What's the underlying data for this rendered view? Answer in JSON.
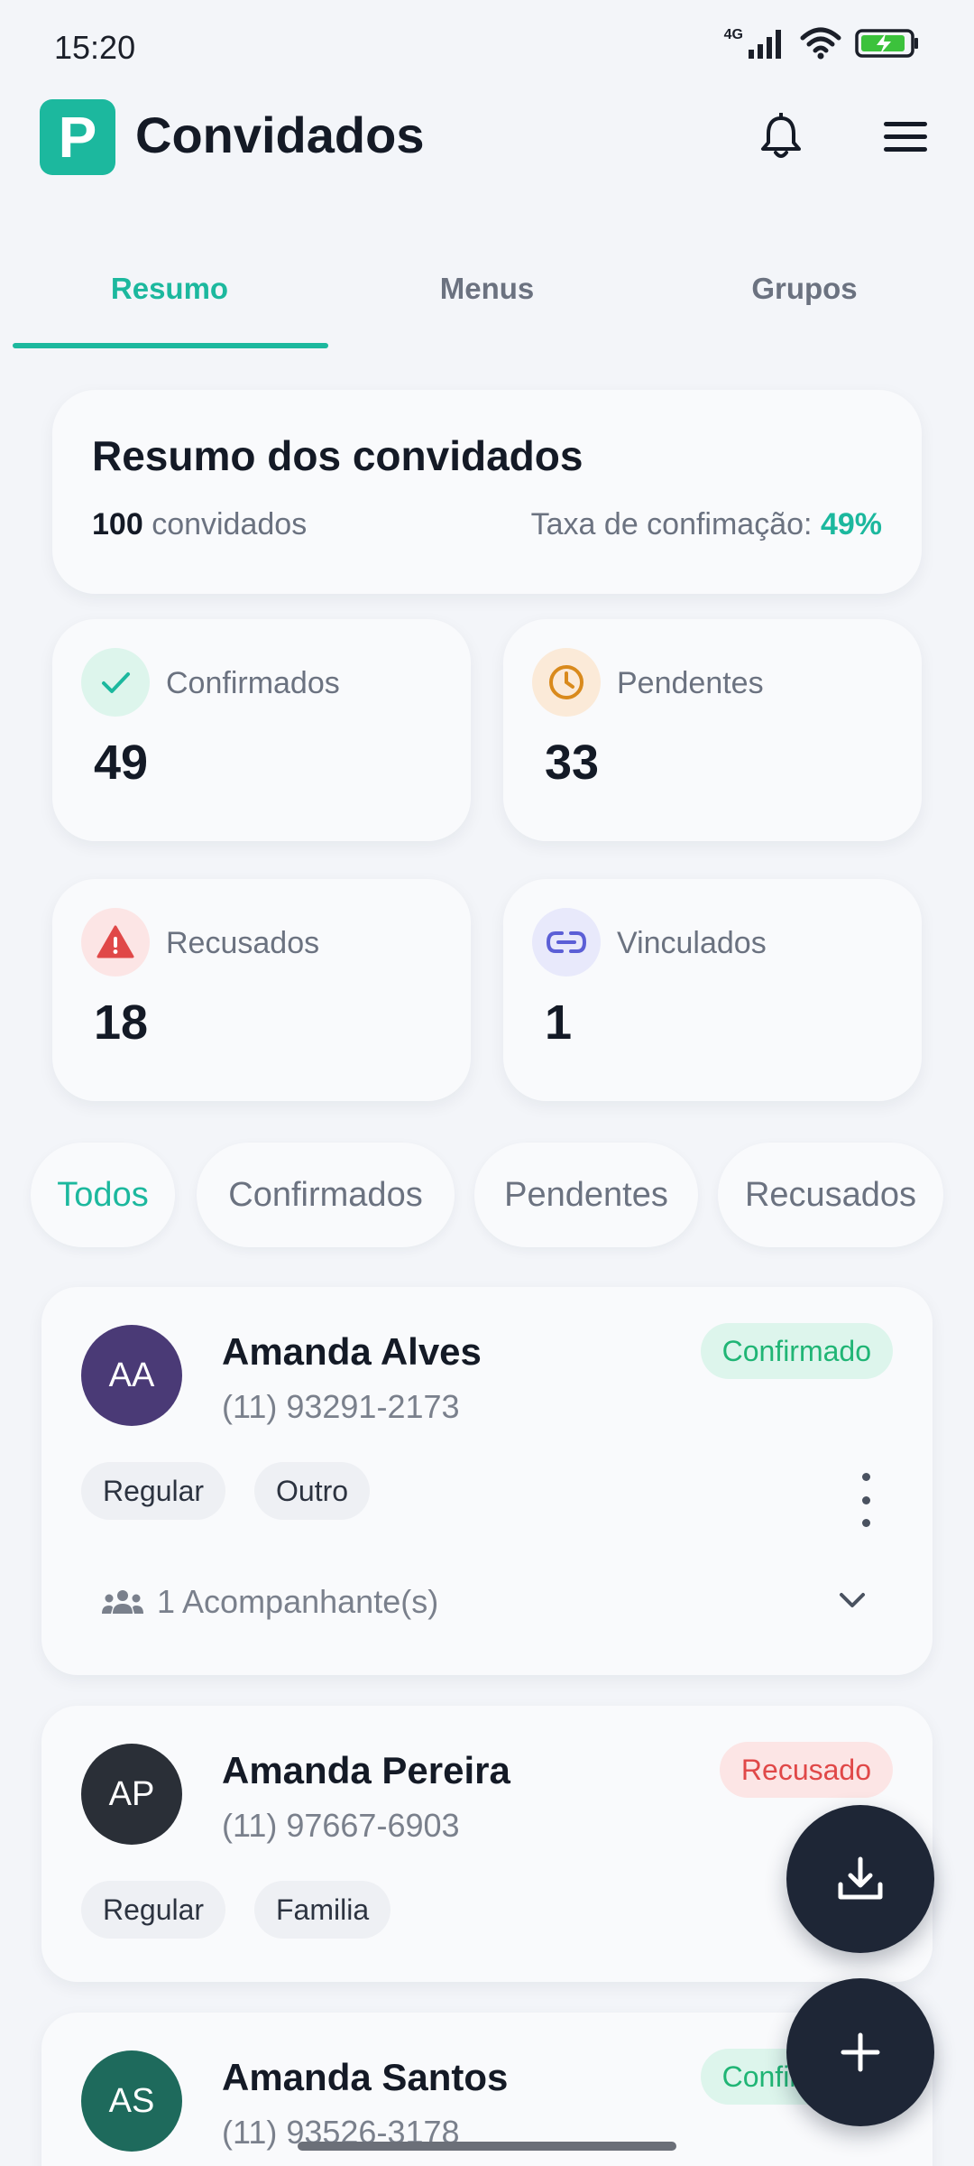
{
  "status": {
    "time": "15:20",
    "network": "4G"
  },
  "header": {
    "logo_letter": "P",
    "title": "Convidados"
  },
  "tabs": [
    {
      "label": "Resumo"
    },
    {
      "label": "Menus"
    },
    {
      "label": "Grupos"
    }
  ],
  "summary": {
    "title": "Resumo dos convidados",
    "total": "100",
    "total_label": "convidados",
    "rate_label": "Taxa de confimação:",
    "rate_value": "49%"
  },
  "stats": [
    {
      "label": "Confirmados",
      "value": "49",
      "icon": "check-icon",
      "color": "#1cb89e"
    },
    {
      "label": "Pendentes",
      "value": "33",
      "icon": "clock-icon",
      "color": "#d98a1c"
    },
    {
      "label": "Recusados",
      "value": "18",
      "icon": "warning-icon",
      "color": "#e04848"
    },
    {
      "label": "Vinculados",
      "value": "1",
      "icon": "link-icon",
      "color": "#5b5fd6"
    }
  ],
  "filters": [
    {
      "label": "Todos"
    },
    {
      "label": "Confirmados"
    },
    {
      "label": "Pendentes"
    },
    {
      "label": "Recusados"
    }
  ],
  "guests": [
    {
      "initials": "AA",
      "name": "Amanda Alves",
      "phone": "(11) 93291-2173",
      "status": "Confirmado",
      "tags": [
        "Regular",
        "Outro"
      ],
      "companions": "1 Acompanhante(s)",
      "avatar_color": "#4a3a76"
    },
    {
      "initials": "AP",
      "name": "Amanda Pereira",
      "phone": "(11) 97667-6903",
      "status": "Recusado",
      "tags": [
        "Regular",
        "Familia"
      ],
      "avatar_color": "#2a2f37"
    },
    {
      "initials": "AS",
      "name": "Amanda Santos",
      "phone": "(11) 93526-3178",
      "status": "Confirmado",
      "avatar_color": "#1e6a5c"
    }
  ]
}
